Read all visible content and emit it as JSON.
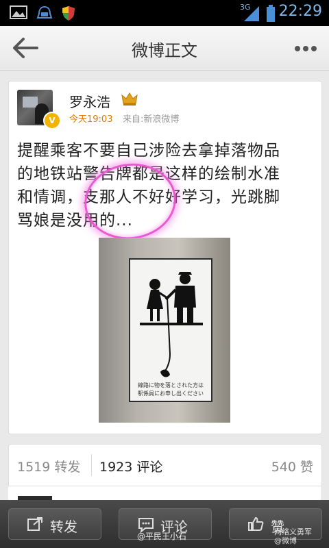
{
  "status_bar": {
    "network": "3G",
    "time": "22:29"
  },
  "header": {
    "title": "微博正文",
    "back_icon": "back-arrow-icon",
    "more_icon": "more-dots-icon"
  },
  "post": {
    "username": "罗永浩",
    "verified_badge": "V",
    "time": "今天19:03",
    "source": "来自:新浪微博",
    "text_lines": [
      "提醒乘客不要自己涉险去拿掉落物品",
      "的地铁站警告牌都是这样的绘制水准",
      "和情调，支那人不好好学习，光跳脚",
      "骂娘是没用的..."
    ],
    "image_caption_lines": [
      "線路に物を落とされた方は",
      "駅係員にお申し出ください"
    ],
    "highlight_color": "#e85ad0"
  },
  "stats": {
    "reposts": "1519 转发",
    "comments": "1923 评论",
    "likes": "540 赞"
  },
  "toolbar": {
    "repost_label": "转发",
    "comment_label": "评论",
    "like_label": "赞"
  },
  "watermarks": {
    "left": "@平民王小石",
    "right_line1": "网络义勇军",
    "right_line2": "@微博"
  }
}
